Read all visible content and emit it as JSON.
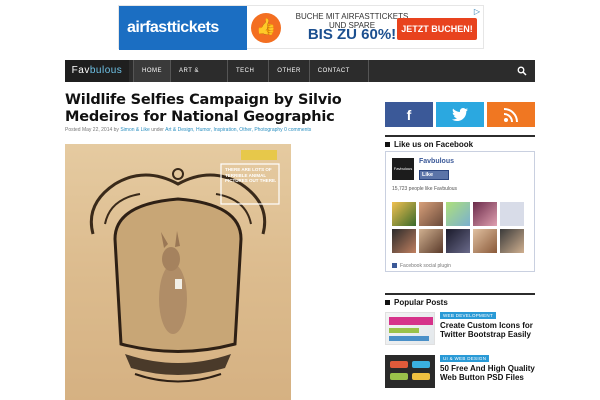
{
  "ad": {
    "brand": "airfasttickets",
    "line1": "BUCHE MIT AIRFASTTICKETS UND SPARE",
    "line2": "BIS ZU 60%!",
    "cta": "JETZT BUCHEN!",
    "choices": "▷"
  },
  "nav": {
    "brand_a": "Fav",
    "brand_b": "bulous",
    "items": [
      "HOME",
      "ART &",
      "TECH",
      "OTHER",
      "CONTACT"
    ],
    "search_icon": "search-icon"
  },
  "article": {
    "title": "Wildlife Selfies Campaign by Silvio Medeiros for National Geographic",
    "meta_prefix": "Posted May 22, 2014 by",
    "meta_author": "Simon & Like",
    "meta_mid": "under",
    "meta_cats": "Art & Design, Humor, Inspiration, Other, Photography",
    "meta_comments": "0 comments",
    "hero_caption": "THERE ARE LOTS OF TERRIBLE ANIMAL PICTURES OUT THERE."
  },
  "sidebar": {
    "social": [
      "f",
      "t",
      "rss"
    ],
    "facebook_heading": "Like us on Facebook",
    "fb_page_name": "Favbulous",
    "fb_like_label": "Like",
    "fb_count": "15,723 people like Favbulous",
    "fb_plugin": "Facebook social plugin",
    "popular_heading": "Popular Posts",
    "posts": [
      {
        "category": "WEB DEVELOPMENT",
        "title": "Create Custom Icons for Twitter Bootstrap Easily"
      },
      {
        "category": "UI & WEB DESIGN",
        "title": "50 Free And High Quality Web Button PSD Files"
      }
    ]
  },
  "colors": {
    "nav_bg": "#2c2c2c",
    "accent": "#2a9ad6",
    "facebook": "#3b5998",
    "twitter": "#2ba8e0",
    "rss": "#f07722"
  }
}
